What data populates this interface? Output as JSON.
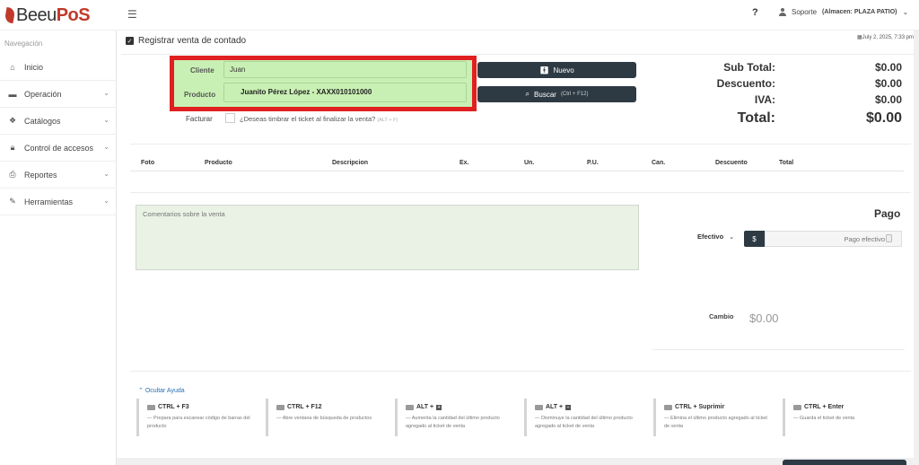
{
  "app": {
    "logo_text_1": "Beeu",
    "logo_text_2": "PoS"
  },
  "header": {
    "help": "?",
    "user": "Soporte",
    "store": "(Almacen: PLAZA PATIO)"
  },
  "sidebar": {
    "title": "Navegación",
    "items": [
      {
        "label": "Inicio",
        "icon": "home-icon"
      },
      {
        "label": "Operación",
        "icon": "briefcase-icon"
      },
      {
        "label": "Catálogos",
        "icon": "cubes-icon"
      },
      {
        "label": "Control de accesos",
        "icon": "lock-icon"
      },
      {
        "label": "Reportes",
        "icon": "print-icon"
      },
      {
        "label": "Herramientas",
        "icon": "wrench-icon"
      }
    ]
  },
  "page": {
    "title": "Registrar venta de contado",
    "date": "July 2, 2025, 7:33 pm"
  },
  "form": {
    "cliente_label": "Cliente",
    "cliente_value": "Juan",
    "producto_label": "Producto",
    "suggestion": "Juanito Pérez López - XAXX010101000",
    "nuevo_button": "Nuevo",
    "buscar_button": "Buscar",
    "buscar_shortcut": "(Ctrl + F12)",
    "facturar_label": "Facturar",
    "facturar_text": "¿Deseas timbrar el ticket al finalizar la venta?",
    "facturar_shortcut": "(ALT + F)"
  },
  "totals": {
    "subtotal_label": "Sub Total:",
    "subtotal": "$0.00",
    "descuento_label": "Descuento:",
    "descuento": "$0.00",
    "iva_label": "IVA:",
    "iva": "$0.00",
    "total_label": "Total:",
    "total": "$0.00"
  },
  "table": {
    "headers": [
      "Foto",
      "Producto",
      "Descripcion",
      "Ex.",
      "Un.",
      "P.U.",
      "Can.",
      "Descuento",
      "Total"
    ]
  },
  "comments": {
    "placeholder": "Comentarios sobre la venta"
  },
  "payment": {
    "title": "Pago",
    "method": "Efectivo",
    "currency": "$",
    "placeholder": "Pago efectivo",
    "cambio_label": "Cambio",
    "cambio_value": "$0.00"
  },
  "help": {
    "toggle": "Ocultar Ayuda",
    "items": [
      {
        "key": "CTRL + F3",
        "desc": "— Prepara para escanear código de barras del producto"
      },
      {
        "key": "CTRL + F12",
        "desc": "— Abre ventana de búsqueda de productos"
      },
      {
        "key": "ALT +",
        "desc": "— Aumenta la cantidad del último producto agregado al ticket de venta"
      },
      {
        "key": "ALT +",
        "desc": "— Disminuye la cantidad del último producto agregado al ticket de venta"
      },
      {
        "key": "CTRL + Suprimir",
        "desc": "— Elimina el último producto agregado al ticket de venta"
      },
      {
        "key": "CTRL + Enter",
        "desc": "— Guarda el ticket de venta"
      }
    ]
  }
}
